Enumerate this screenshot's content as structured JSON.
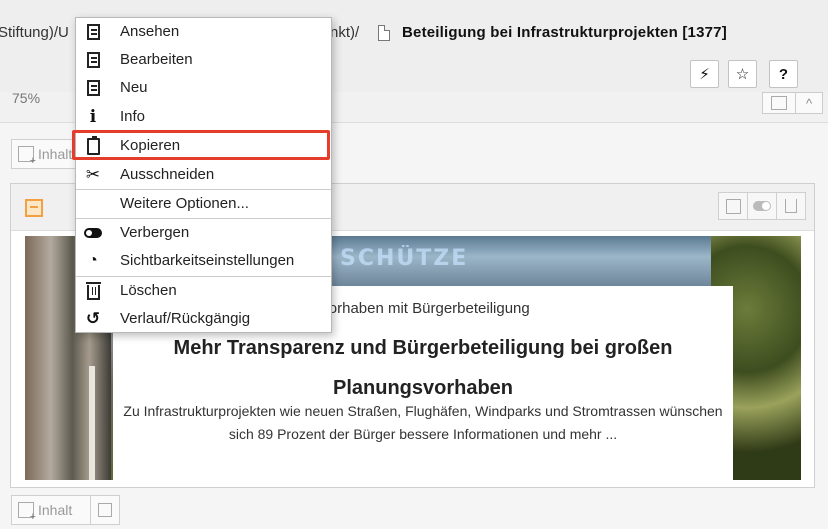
{
  "breadcrumb": {
    "segment_left": "Stiftung)/U",
    "segment_mid": "nkt)/",
    "title": "Beteiligung bei Infrastrukturprojekten [1377]"
  },
  "toolbar": {
    "flash_label": "⚡",
    "star_label": "☆",
    "help_label": "?"
  },
  "zoom": {
    "value": "75%",
    "collapse_label": "^"
  },
  "inhalt_button_label": "Inhalt",
  "context_menu": {
    "items": [
      {
        "label": "Ansehen",
        "icon": "view-icon"
      },
      {
        "label": "Bearbeiten",
        "icon": "edit-icon"
      },
      {
        "label": "Neu",
        "icon": "new-icon"
      },
      {
        "label": "Info",
        "icon": "info-icon"
      },
      {
        "label": "Kopieren",
        "icon": "copy-icon"
      },
      {
        "label": "Ausschneiden",
        "icon": "cut-icon"
      },
      {
        "label": "Weitere Optionen...",
        "icon": ""
      },
      {
        "label": "Verbergen",
        "icon": "toggle-icon"
      },
      {
        "label": "Sichtbarkeitseinstellungen",
        "icon": "visibility-settings-icon"
      },
      {
        "label": "Löschen",
        "icon": "trash-icon"
      },
      {
        "label": "Verlauf/Rückgängig",
        "icon": "history-icon"
      }
    ],
    "highlighted_item": "Kopieren",
    "highlight_color": "#e53c2c"
  },
  "teaser": {
    "kicker": "rvorhaben mit Bürgerbeteiligung",
    "headline": "Mehr Transparenz und Bürgerbeteiligung bei großen Planungsvorhaben",
    "body": "Zu Infrastrukturprojekten wie neuen Straßen, Flughäfen, Windparks und Stromtrassen wünschen sich 89 Prozent der Bürger bessere Informationen und mehr ...",
    "image_graffiti": "SCHÜTZE"
  },
  "colors": {
    "accent_orange": "#f2a042",
    "header_bg": "#eeeeee"
  }
}
